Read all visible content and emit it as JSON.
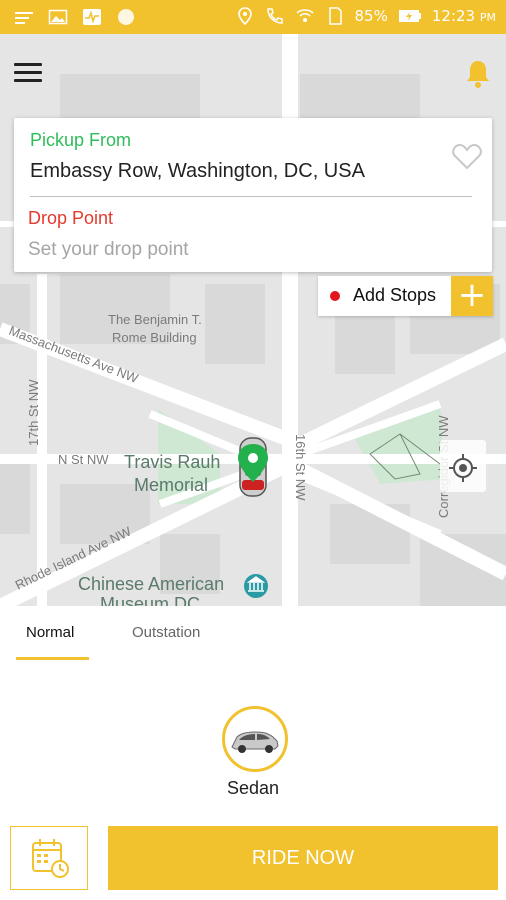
{
  "status_bar": {
    "battery": "85%",
    "time": "12:23",
    "time_suffix": "PM",
    "left_icons": [
      "notification-icon",
      "image-icon",
      "activity-icon",
      "circle-icon"
    ],
    "right_icons": [
      "location-icon",
      "call-icon",
      "wifi-icon",
      "sim-icon",
      "battery-icon"
    ]
  },
  "header": {
    "menu_icon": "menu-icon",
    "bell_icon": "bell-icon"
  },
  "trip": {
    "pickup_label": "Pickup From",
    "pickup_value": "Embassy Row, Washington, DC, USA",
    "drop_label": "Drop Point",
    "drop_placeholder": "Set your drop point",
    "add_stops_label": "Add Stops",
    "add_stops_plus": "+"
  },
  "map": {
    "labels": {
      "benjamin": "The Benjamin T.",
      "rome": "Rome Building",
      "mass_ave": "Massachusetts Ave NW",
      "st17": "17th St NW",
      "nst": "N St NW",
      "travis1": "Travis Rauh",
      "travis2": "Memorial",
      "st16": "16th St NW",
      "corregidor": "Corregidor St NW",
      "rhode": "Rhode Island Ave NW",
      "chinese1": "Chinese American",
      "chinese2": "Museum DC"
    }
  },
  "tabs": [
    {
      "label": "Normal",
      "active": true
    },
    {
      "label": "Outstation",
      "active": false
    }
  ],
  "vehicles": [
    {
      "label": "Sedan",
      "icon": "sedan-car-icon"
    }
  ],
  "actions": {
    "schedule_icon": "calendar-clock-icon",
    "ride_now_label": "RIDE NOW"
  },
  "colors": {
    "accent": "#f2c12e",
    "pickup_green": "#2ebd5b",
    "drop_red": "#e23b2d",
    "map_park": "#cfe8d4",
    "marker_green": "#23b14d"
  }
}
